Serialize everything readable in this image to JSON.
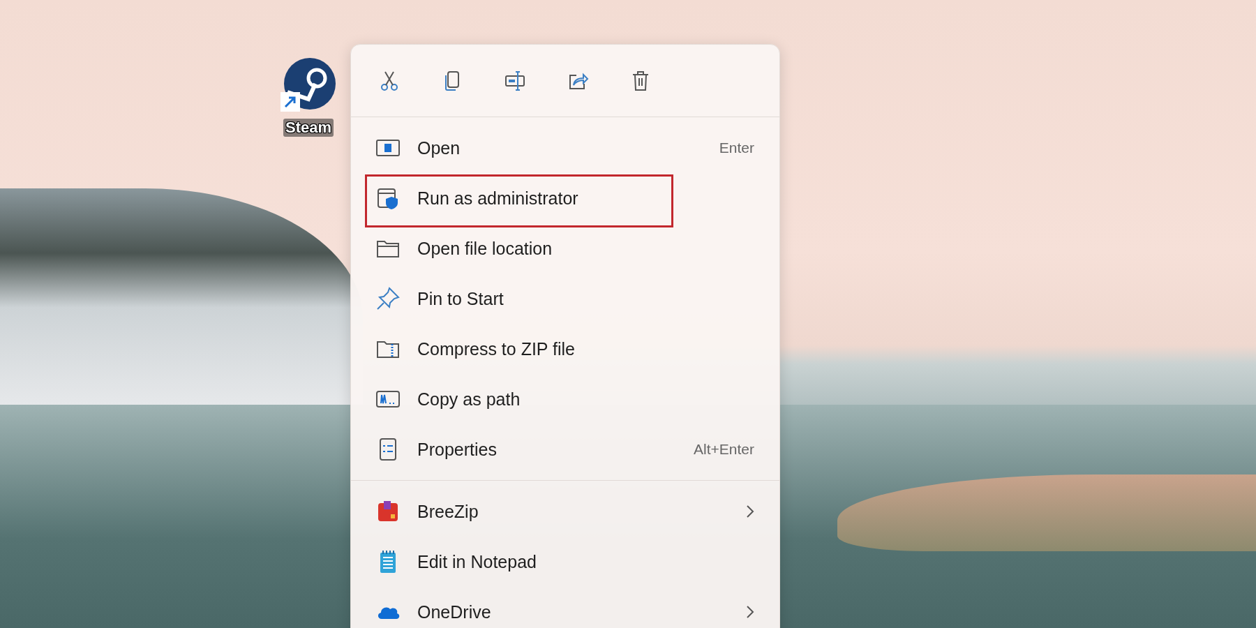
{
  "desktop_icon": {
    "label": "Steam"
  },
  "context_menu": {
    "toolbar": [
      {
        "kind": "cut"
      },
      {
        "kind": "copy"
      },
      {
        "kind": "rename"
      },
      {
        "kind": "share"
      },
      {
        "kind": "delete"
      }
    ],
    "sections": [
      {
        "items": [
          {
            "kind": "open",
            "label": "Open",
            "shortcut": "Enter",
            "highlighted": false,
            "submenu": false
          },
          {
            "kind": "admin",
            "label": "Run as administrator",
            "highlighted": true,
            "submenu": false
          },
          {
            "kind": "folder",
            "label": "Open file location",
            "highlighted": false,
            "submenu": false
          },
          {
            "kind": "pin",
            "label": "Pin to Start",
            "highlighted": false,
            "submenu": false
          },
          {
            "kind": "zip",
            "label": "Compress to ZIP file",
            "highlighted": false,
            "submenu": false
          },
          {
            "kind": "path",
            "label": "Copy as path",
            "highlighted": false,
            "submenu": false
          },
          {
            "kind": "properties",
            "label": "Properties",
            "shortcut": "Alt+Enter",
            "highlighted": false,
            "submenu": false
          }
        ]
      },
      {
        "items": [
          {
            "kind": "breezip",
            "label": "BreeZip",
            "highlighted": false,
            "submenu": true
          },
          {
            "kind": "notepad",
            "label": "Edit in Notepad",
            "highlighted": false,
            "submenu": false
          },
          {
            "kind": "cloud",
            "label": "OneDrive",
            "highlighted": false,
            "submenu": true
          }
        ]
      }
    ]
  }
}
